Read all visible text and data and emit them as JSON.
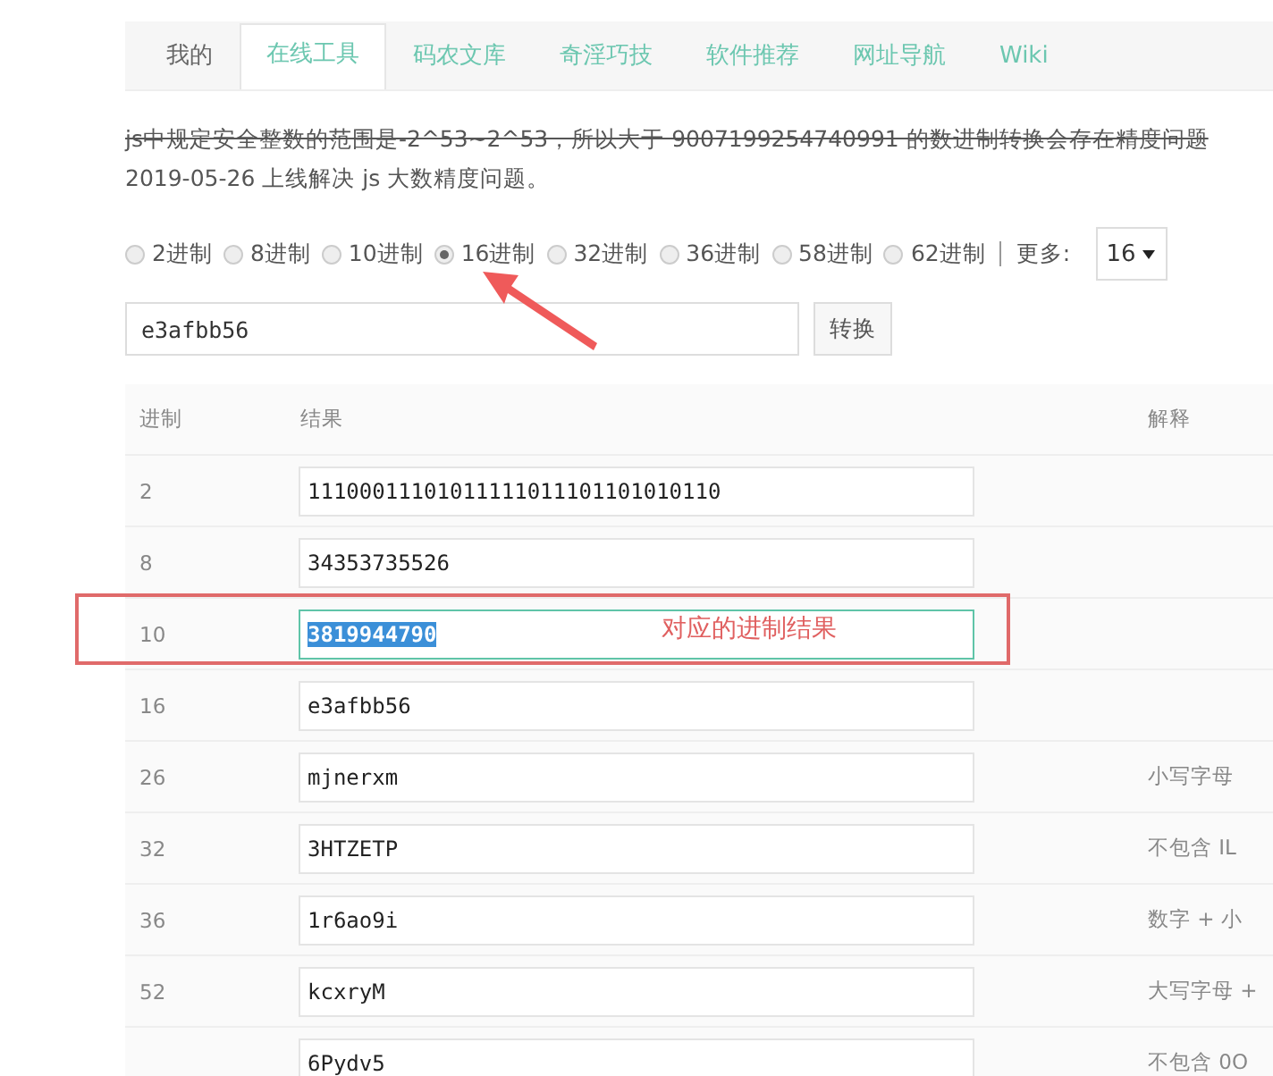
{
  "tabs": [
    {
      "label": "我的",
      "selected": false,
      "kind": "plain"
    },
    {
      "label": "在线工具",
      "selected": true,
      "kind": "link"
    },
    {
      "label": "码农文库",
      "selected": false,
      "kind": "link"
    },
    {
      "label": "奇淫巧技",
      "selected": false,
      "kind": "link"
    },
    {
      "label": "软件推荐",
      "selected": false,
      "kind": "link"
    },
    {
      "label": "网址导航",
      "selected": false,
      "kind": "link"
    },
    {
      "label": "Wiki",
      "selected": false,
      "kind": "link"
    }
  ],
  "notice": {
    "text": "js中规定安全整数的范围是-2^53~2^53，所以大于 9007199254740991 的数进制转换会存在精度问题",
    "struck": true
  },
  "update_note": "2019-05-26 上线解决 js 大数精度问题。",
  "bases": [
    {
      "label": "2进制",
      "selected": false
    },
    {
      "label": "8进制",
      "selected": false
    },
    {
      "label": "10进制",
      "selected": false
    },
    {
      "label": "16进制",
      "selected": true
    },
    {
      "label": "32进制",
      "selected": false
    },
    {
      "label": "36进制",
      "selected": false
    },
    {
      "label": "58进制",
      "selected": false
    },
    {
      "label": "62进制",
      "selected": false
    }
  ],
  "more_label": "更多:",
  "more_select": "16",
  "input": {
    "value": "e3afbb56"
  },
  "convert_button": "转换",
  "table": {
    "columns": [
      "进制",
      "结果",
      "解释"
    ],
    "rows": [
      {
        "base": "2",
        "result": "11100011101011111011101101010110",
        "focused": false
      },
      {
        "base": "8",
        "result": "34353735526",
        "focused": false
      },
      {
        "base": "10",
        "result": "3819944790",
        "focused": true,
        "annotated": true
      },
      {
        "base": "16",
        "result": "e3afbb56",
        "focused": false
      },
      {
        "base": "26",
        "result": "mjnerxm",
        "note": "小写字母",
        "focused": false
      },
      {
        "base": "32",
        "result": "3HTZETP",
        "note": "不包含 IL",
        "focused": false
      },
      {
        "base": "36",
        "result": "1r6ao9i",
        "note": "数字 + 小",
        "focused": false
      },
      {
        "base": "52",
        "result": "kcxryM",
        "note": "大写字母 +",
        "focused": false
      },
      {
        "result": "6Pydv5",
        "note": "不包含 0O",
        "focused": false
      }
    ]
  },
  "annotation": {
    "text": "对应的进制结果"
  }
}
